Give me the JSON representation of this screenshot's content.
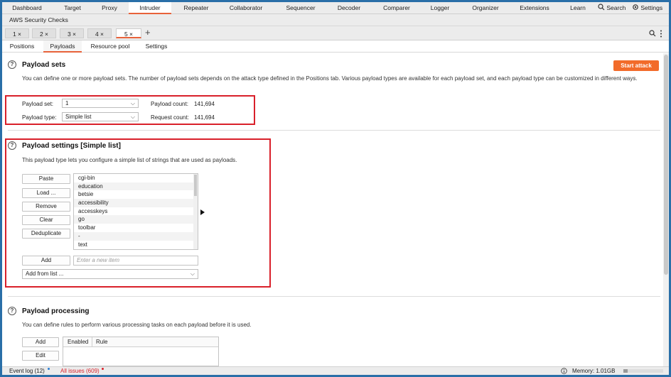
{
  "top_tabs": [
    "Dashboard",
    "Target",
    "Proxy",
    "Intruder",
    "Repeater",
    "Collaborator",
    "Sequencer",
    "Decoder",
    "Comparer",
    "Logger",
    "Organizer",
    "Extensions",
    "Learn"
  ],
  "active_top_tab": "Intruder",
  "search_label": "Search",
  "settings_label": "Settings",
  "extension_tab": "AWS Security Checks",
  "attack_tabs": [
    "1 ×",
    "2 ×",
    "3 ×",
    "4 ×",
    "5 ×"
  ],
  "active_attack_tab": "5 ×",
  "new_tab_glyph": "+",
  "sub_tabs": [
    "Positions",
    "Payloads",
    "Resource pool",
    "Settings"
  ],
  "active_sub_tab": "Payloads",
  "payload_sets": {
    "title": "Payload sets",
    "description": "You can define one or more payload sets. The number of payload sets depends on the attack type defined in the Positions tab. Various payload types are available for each payload set, and each payload type can be customized in different ways.",
    "start_attack": "Start attack",
    "payload_set_label": "Payload set:",
    "payload_set_value": "1",
    "payload_type_label": "Payload type:",
    "payload_type_value": "Simple list",
    "payload_count_label": "Payload count:",
    "payload_count_value": "141,694",
    "request_count_label": "Request count:",
    "request_count_value": "141,694"
  },
  "payload_settings": {
    "title": "Payload settings [Simple list]",
    "description": "This payload type lets you configure a simple list of strings that are used as payloads.",
    "buttons": [
      "Paste",
      "Load ...",
      "Remove",
      "Clear",
      "Deduplicate"
    ],
    "items": [
      "cgi-bin",
      "education",
      "betsie",
      "accessibility",
      "accesskeys",
      "go",
      "toolbar",
      "-",
      "text"
    ],
    "add_button": "Add",
    "add_placeholder": "Enter a new item",
    "add_from_list": "Add from list ..."
  },
  "payload_processing": {
    "title": "Payload processing",
    "description": "You can define rules to perform various processing tasks on each payload before it is used.",
    "buttons": [
      "Add",
      "Edit"
    ],
    "columns": [
      "Enabled",
      "Rule"
    ]
  },
  "status_bar": {
    "event_log": "Event log (12)",
    "all_issues": "All issues (609)",
    "memory": "Memory: 1.01GB"
  },
  "colors": {
    "accent": "#f26b2a",
    "highlight_box": "#d9202a",
    "issues_text": "#d9202a"
  }
}
